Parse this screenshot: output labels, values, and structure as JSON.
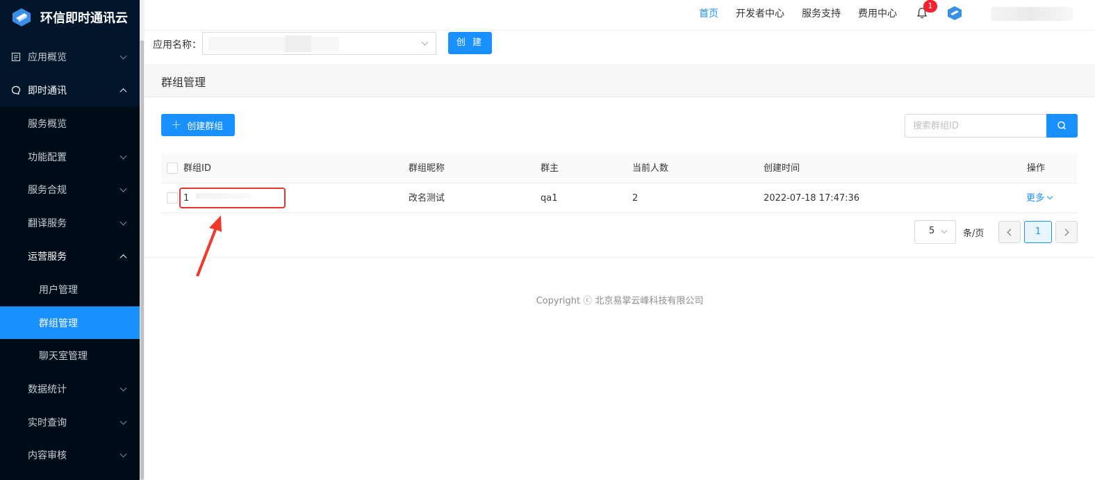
{
  "sidebar": {
    "brand": "环信即时通讯云",
    "items": [
      {
        "label": "应用概览",
        "level": 1,
        "state": "collapsed",
        "icon": "document-icon"
      },
      {
        "label": "即时通讯",
        "level": 1,
        "state": "expanded",
        "icon": "chat-icon"
      },
      {
        "label": "服务概览",
        "level": 2
      },
      {
        "label": "功能配置",
        "level": 2,
        "state": "collapsed"
      },
      {
        "label": "服务合规",
        "level": 2,
        "state": "collapsed"
      },
      {
        "label": "翻译服务",
        "level": 2,
        "state": "collapsed"
      },
      {
        "label": "运营服务",
        "level": 2,
        "state": "expanded"
      },
      {
        "label": "用户管理",
        "level": 3
      },
      {
        "label": "群组管理",
        "level": 3,
        "active": true
      },
      {
        "label": "聊天室管理",
        "level": 3
      },
      {
        "label": "数据统计",
        "level": 2,
        "state": "collapsed"
      },
      {
        "label": "实时查询",
        "level": 2,
        "state": "collapsed"
      },
      {
        "label": "内容审核",
        "level": 2,
        "state": "collapsed"
      }
    ]
  },
  "header": {
    "nav": [
      "首页",
      "开发者中心",
      "服务支持",
      "费用中心"
    ],
    "active_nav": "首页",
    "notification_count": "1"
  },
  "app_selector": {
    "label": "应用名称：",
    "create_label": "创 建"
  },
  "page": {
    "title": "群组管理",
    "add_button": "创建群组",
    "search_placeholder": "搜索群组ID"
  },
  "table": {
    "columns": [
      "群组ID",
      "群组昵称",
      "群主",
      "当前人数",
      "创建时间",
      "操作"
    ],
    "rows": [
      {
        "id": "1",
        "nickname": "改名测试",
        "owner": "qa1",
        "members": "2",
        "created": "2022-07-18 17:47:36",
        "action": "更多"
      }
    ]
  },
  "pagination": {
    "page_size": "5",
    "per_page_label": "条/页",
    "current_page": "1"
  },
  "footer": {
    "copyright": "Copyright ⓒ 北京易掌云峰科技有限公司"
  },
  "colors": {
    "primary": "#1890ff",
    "sidebar_bg": "#001529",
    "badge": "#f5222d",
    "annotation": "#e8342a"
  }
}
